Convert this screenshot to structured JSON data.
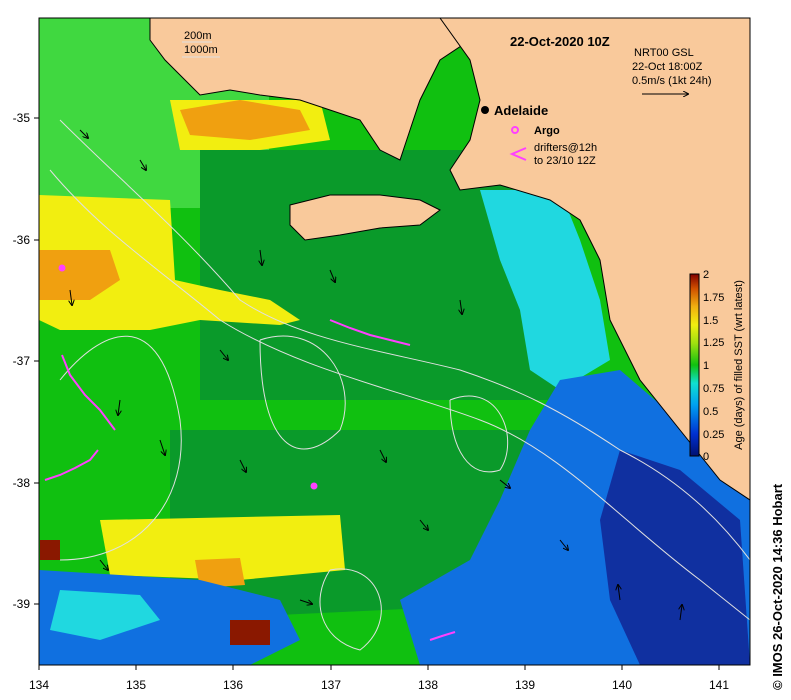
{
  "map": {
    "title": "22-Oct-2020 10Z",
    "product": "NRT00 GSL",
    "valid_time": "22-Oct 18:00Z",
    "vector_scale": "0.5m/s (1kt 24h)",
    "isobath_labels": [
      "200m",
      "1000m"
    ],
    "city": "Adelaide",
    "argo_label": "Argo",
    "drifters_label": "drifters@12h",
    "drifters_period": "to 23/10 12Z",
    "lon_ticks": [
      "134",
      "135",
      "136",
      "137",
      "138",
      "139",
      "140",
      "141"
    ],
    "lat_ticks": [
      "-35",
      "-36",
      "-37",
      "-38",
      "-39"
    ],
    "colorbar": {
      "label": "Age (days) of filled SST (wrt latest)",
      "ticks": [
        "0",
        "0.25",
        "0.5",
        "0.75",
        "1",
        "1.25",
        "1.5",
        "1.75",
        "2"
      ]
    },
    "credit": "© IMOS 26-Oct-2020 14:36 Hobart",
    "colors": {
      "land": "#f9c99b",
      "green": "#10c010",
      "lime": "#40d840",
      "dark_green": "#0a9a2a",
      "yellow": "#f2ee10",
      "orange": "#f0a010",
      "dark_red": "#8a1800",
      "cyan": "#20d8e0",
      "blue": "#1070e0",
      "navy": "#1030a0",
      "drifter": "#ff40ff"
    }
  }
}
